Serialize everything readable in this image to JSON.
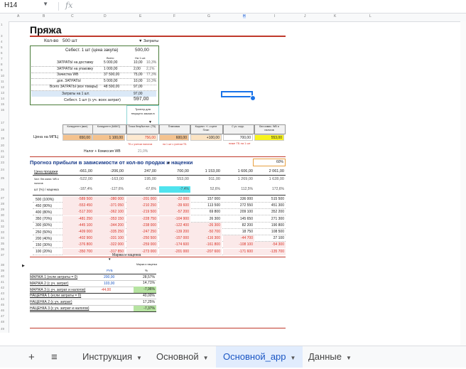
{
  "formula_bar": {
    "cell": "H14",
    "fx": "fx"
  },
  "columns": [
    "A",
    "B",
    "C",
    "D",
    "E",
    "F",
    "G",
    "H",
    "I",
    "J",
    "K",
    "L"
  ],
  "rows": [
    "1",
    "3",
    "4",
    "5",
    "6",
    "7",
    "8",
    "9",
    "10",
    "11",
    "12",
    "13",
    "14",
    "15",
    "16",
    "17",
    "18",
    "19",
    "20",
    "21",
    "22",
    "23",
    "24",
    "25",
    "26",
    "27",
    "28",
    "29",
    "30",
    "31",
    "32",
    "33",
    "34",
    "35",
    "36",
    "37",
    "38",
    "39",
    "40",
    "41",
    "42",
    "43",
    "44",
    "45",
    "46",
    "47",
    "48",
    "49"
  ],
  "sheet": {
    "title": "Пряжа",
    "qty_label": "Кол-во",
    "qty_value": "500 шт",
    "costs_toggle": "▼ Затраты",
    "cost_header": "Себест. 1 шт (цена закупа)",
    "cost_value": "500,00",
    "col_total": "Всего",
    "col_per_unit": "На 1 шт.",
    "cost_rows": [
      {
        "label": "ЗАТРАТЫ на доставку",
        "total": "5 000,00",
        "unit": "10,00",
        "pct": "10,3%"
      },
      {
        "label": "ЗАТРАТЫ на упаковку",
        "total": "1 000,00",
        "unit": "2,00",
        "pct": "2,1%"
      },
      {
        "label": "Зачистка WB",
        "total": "37 500,00",
        "unit": "75,00",
        "pct": "77,3%"
      },
      {
        "label": "доп. ЗАТРАТЫ",
        "total": "5 000,00",
        "unit": "10,00",
        "pct": "10,3%"
      },
      {
        "label": "Всего ЗАТРАТЫ (все товары)",
        "total": "48 500,00",
        "unit": "97,00",
        "pct": ""
      }
    ],
    "per_unit_costs_label": "Затраты на 1 шт.",
    "per_unit_costs_value": "97,00",
    "cost_full_label": "Себест. 1 шт (с уч. всех затрат)",
    "cost_full_value": "597,00",
    "trigger_label": "Триггер для текущего заказа в",
    "price_headers": [
      "Конкурентн (мин)",
      "Конкурентн (МАКС)",
      "Точка безубыточн. (ТБ)",
      "Плановая",
      "Коррект. +/- к цене План",
      "С уч. корр.",
      "Без комис. WB и налогов"
    ],
    "price_row_label": "Цена на МПЦ",
    "price_values": [
      "650,00",
      "1 100,00",
      "756,00",
      "600,00",
      "+100,00",
      "700,00",
      "553,00"
    ],
    "tb_note": "ТБ с учетом налогов",
    "plan_note": "на 1 шт с учетом ТБ",
    "warn_note": "ниже ТБ на 1 шт",
    "tax_label": "Налог + Комиссия WB",
    "tax_value": "21,0%",
    "forecast_title": "Прогноз прибыли в зависимости от кол-во продаж и наценки",
    "forecast_pct": "60%",
    "sale_price_label": "Цена продажи",
    "sale_prices": [
      "-661,00",
      "-206,00",
      "247,00",
      "700,00",
      "1 153,00",
      "1 606,00",
      "2 061,00"
    ],
    "net_label": "Чист. без комис. WB и налогов",
    "net_values": [
      "-522,00",
      "-163,00",
      "195,00",
      "553,00",
      "911,00",
      "1 269,00",
      "1 628,00"
    ],
    "markup_label": "шт (%) / наценка",
    "markups": [
      "-187,4%",
      "-127,6%",
      "-67,6%",
      "-7,4%",
      "52,6%",
      "112,5%",
      "172,6%"
    ],
    "forecast_rows": [
      {
        "qty": "500 (100%)",
        "v": [
          "-589 500",
          "-380 000",
          "-201 000",
          "-22 000",
          "157 000",
          "336 000",
          "515 500"
        ]
      },
      {
        "qty": "450 (90%)",
        "v": [
          "-553 450",
          "-371 050",
          "-210 250",
          "-39 600",
          "113 500",
          "272 550",
          "451 300"
        ]
      },
      {
        "qty": "400 (80%)",
        "v": [
          "-517 200",
          "-362 100",
          "-219 500",
          "-57 200",
          "69 800",
          "209 100",
          "352 200"
        ]
      },
      {
        "qty": "350 (70%)",
        "v": [
          "-481 250",
          "-353 150",
          "-228 750",
          "-104 900",
          "26 300",
          "145 650",
          "271 300"
        ]
      },
      {
        "qty": "300 (60%)",
        "v": [
          "-445 100",
          "-344 200",
          "-238 000",
          "-122 400",
          "-26 300",
          "82 200",
          "190 800"
        ]
      },
      {
        "qty": "250 (50%)",
        "v": [
          "-409 000",
          "-335 250",
          "-247 250",
          "-139 200",
          "-50 700",
          "18 750",
          "108 500"
        ]
      },
      {
        "qty": "200 (40%)",
        "v": [
          "-402 900",
          "-331 100",
          "-250 500",
          "-157 000",
          "-116 300",
          "-44 700",
          "27 100"
        ]
      },
      {
        "qty": "150 (30%)",
        "v": [
          "-376 800",
          "-322 000",
          "-259 000",
          "-174 600",
          "-161 800",
          "-108 100",
          "-54 300"
        ]
      },
      {
        "qty": "100 (20%)",
        "v": [
          "-350 700",
          "-317 850",
          "-273 000",
          "-201 000",
          "-207 600",
          "-171 600",
          "-135 700"
        ]
      }
    ],
    "markup_block_title": "Маржа и наценка",
    "markup_block_sub": "Маржа и наценка",
    "mk_col_rub": "РУБ",
    "mk_col_pct": "%",
    "mk_rows": [
      {
        "label": "МАРЖА 1 (если затраты = 0)",
        "rub": "200,00",
        "pct": "28,57%",
        "hl": ""
      },
      {
        "label": "МАРЖА 2 (с уч. затрат)",
        "rub": "103,00",
        "pct": "14,71%",
        "hl": ""
      },
      {
        "label": "МАРЖА 3 (с уч. затрат и налогов)",
        "rub": "-44,00",
        "pct": "-7,96%",
        "hl": "green"
      },
      {
        "label": "НАЦЕНКА 1 (если затраты = 0)",
        "rub": "",
        "pct": "40,00%",
        "hl": ""
      },
      {
        "label": "НАЦЕНКА 2 (с уч. затрат)",
        "rub": "",
        "pct": "17,25%",
        "hl": ""
      },
      {
        "label": "НАЦЕНКА 3 (с уч. затрат и налогов)",
        "rub": "",
        "pct": "-7,37%",
        "hl": "green"
      }
    ]
  },
  "tabs": [
    {
      "label": "Инструкция",
      "active": false
    },
    {
      "label": "Основной",
      "active": false
    },
    {
      "label": "Основной_app",
      "active": true
    },
    {
      "label": "Данные",
      "active": false
    }
  ],
  "colors": {
    "accent": "#1a73e8",
    "brand_red": "#c0392b",
    "positive": "#222222",
    "negative": "#d93025"
  }
}
